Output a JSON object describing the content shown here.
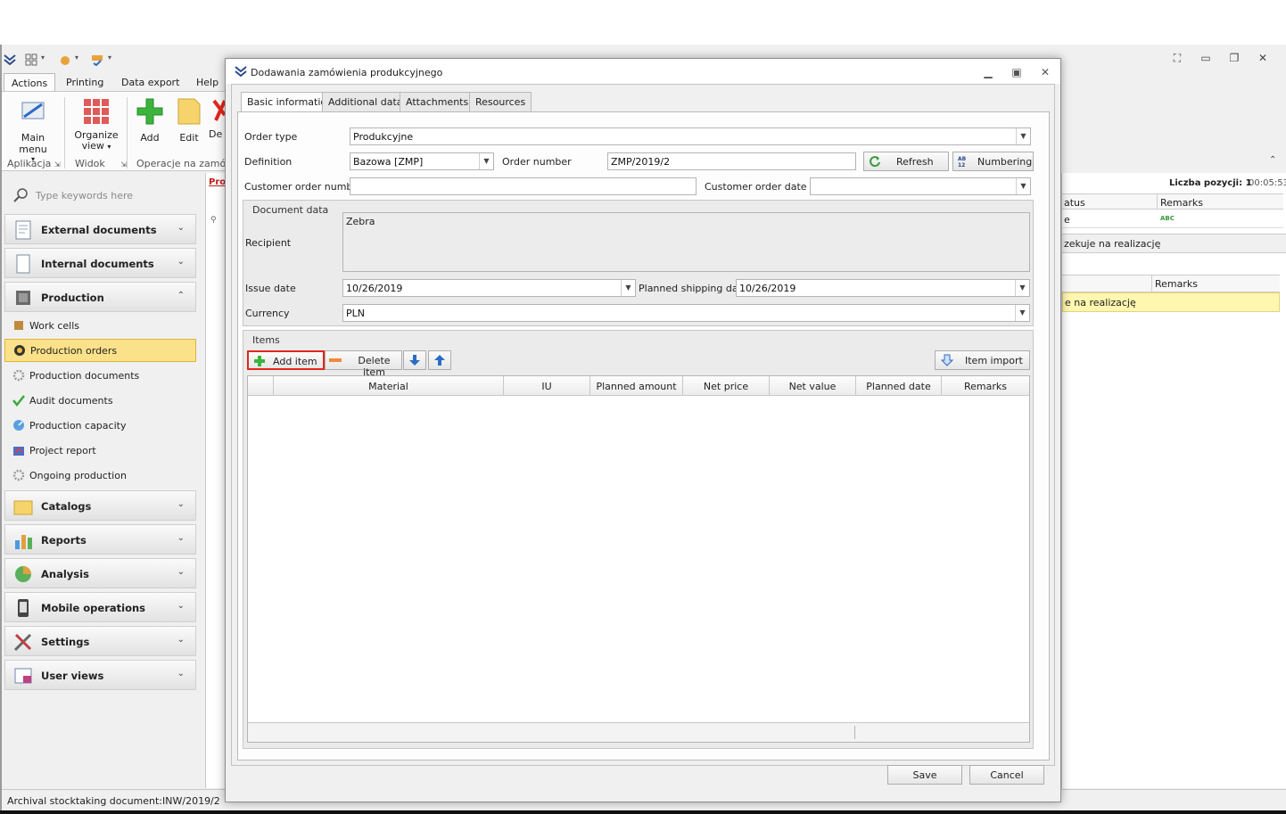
{
  "app": {
    "ribbon_tabs": [
      "Actions",
      "Printing",
      "Data export",
      "Help"
    ],
    "ribbon_buttons": {
      "main_menu": "Main menu",
      "organize_view_line1": "Organize",
      "organize_view_line2": "view",
      "add": "Add",
      "edit": "Edit",
      "delete_partial": "De"
    },
    "ribbon_groups": {
      "aplikacja": "Aplikacja",
      "widok": "Widok",
      "operacje": "Operacje na zamówi"
    },
    "search_placeholder": "Type keywords here",
    "nav_groups": {
      "external": "External documents",
      "internal": "Internal documents",
      "production": "Production",
      "catalogs": "Catalogs",
      "reports": "Reports",
      "analysis": "Analysis",
      "mobile": "Mobile operations",
      "settings": "Settings",
      "userviews": "User views"
    },
    "nav_items": {
      "work_cells": "Work cells",
      "production_orders": "Production orders",
      "production_documents": "Production documents",
      "audit_documents": "Audit documents",
      "production_capacity": "Production capacity",
      "project_report": "Project report",
      "ongoing_production": "Ongoing production"
    },
    "background_panel": {
      "count_label": "Liczba pozycji: 1",
      "timer": "00:05:53",
      "col_status_partial": "atus",
      "col_remarks": "Remarks",
      "row_status_partial": "e",
      "row_remarks_icon": "ABC",
      "status_text_partial": "zekuje na realizację",
      "col2_remarks": "Remarks",
      "row2_partial": "e na realizację",
      "tab_partial": "Pro"
    },
    "statusbar": "Archival stocktaking document:INW/2019/2"
  },
  "dialog": {
    "title": "Dodawania zamówienia produkcyjnego",
    "tabs": [
      "Basic information",
      "Additional data",
      "Attachments",
      "Resources"
    ],
    "order_type_label": "Order type",
    "order_type_value": "Produkcyjne",
    "definition_label": "Definition",
    "definition_value": "Bazowa [ZMP]",
    "order_number_label": "Order number",
    "order_number_value": "ZMP/2019/2",
    "refresh_button": "Refresh",
    "numbering_button": "Numbering",
    "customer_order_number_label": "Customer order number",
    "customer_order_number_value": "",
    "customer_order_date_label": "Customer order date",
    "customer_order_date_value": "",
    "document_data_header": "Document data",
    "recipient_label": "Recipient",
    "recipient_value": "Zebra",
    "issue_date_label": "Issue date",
    "issue_date_value": "10/26/2019",
    "planned_shipping_label": "Planned shipping date",
    "planned_shipping_value": "10/26/2019",
    "currency_label": "Currency",
    "currency_value": "PLN",
    "items_header": "Items",
    "add_item_button": "Add item",
    "delete_item_button": "Delete item",
    "item_import_button": "Item import",
    "grid_columns": [
      "Material",
      "IU",
      "Planned amount",
      "Net price",
      "Net value",
      "Planned date",
      "Remarks"
    ],
    "grid_rows": [],
    "save_button": "Save",
    "cancel_button": "Cancel"
  },
  "colors": {
    "selected_nav": "#fbe28a",
    "highlight_box": "#e0281c",
    "row_highlight": "#fff7b0"
  }
}
